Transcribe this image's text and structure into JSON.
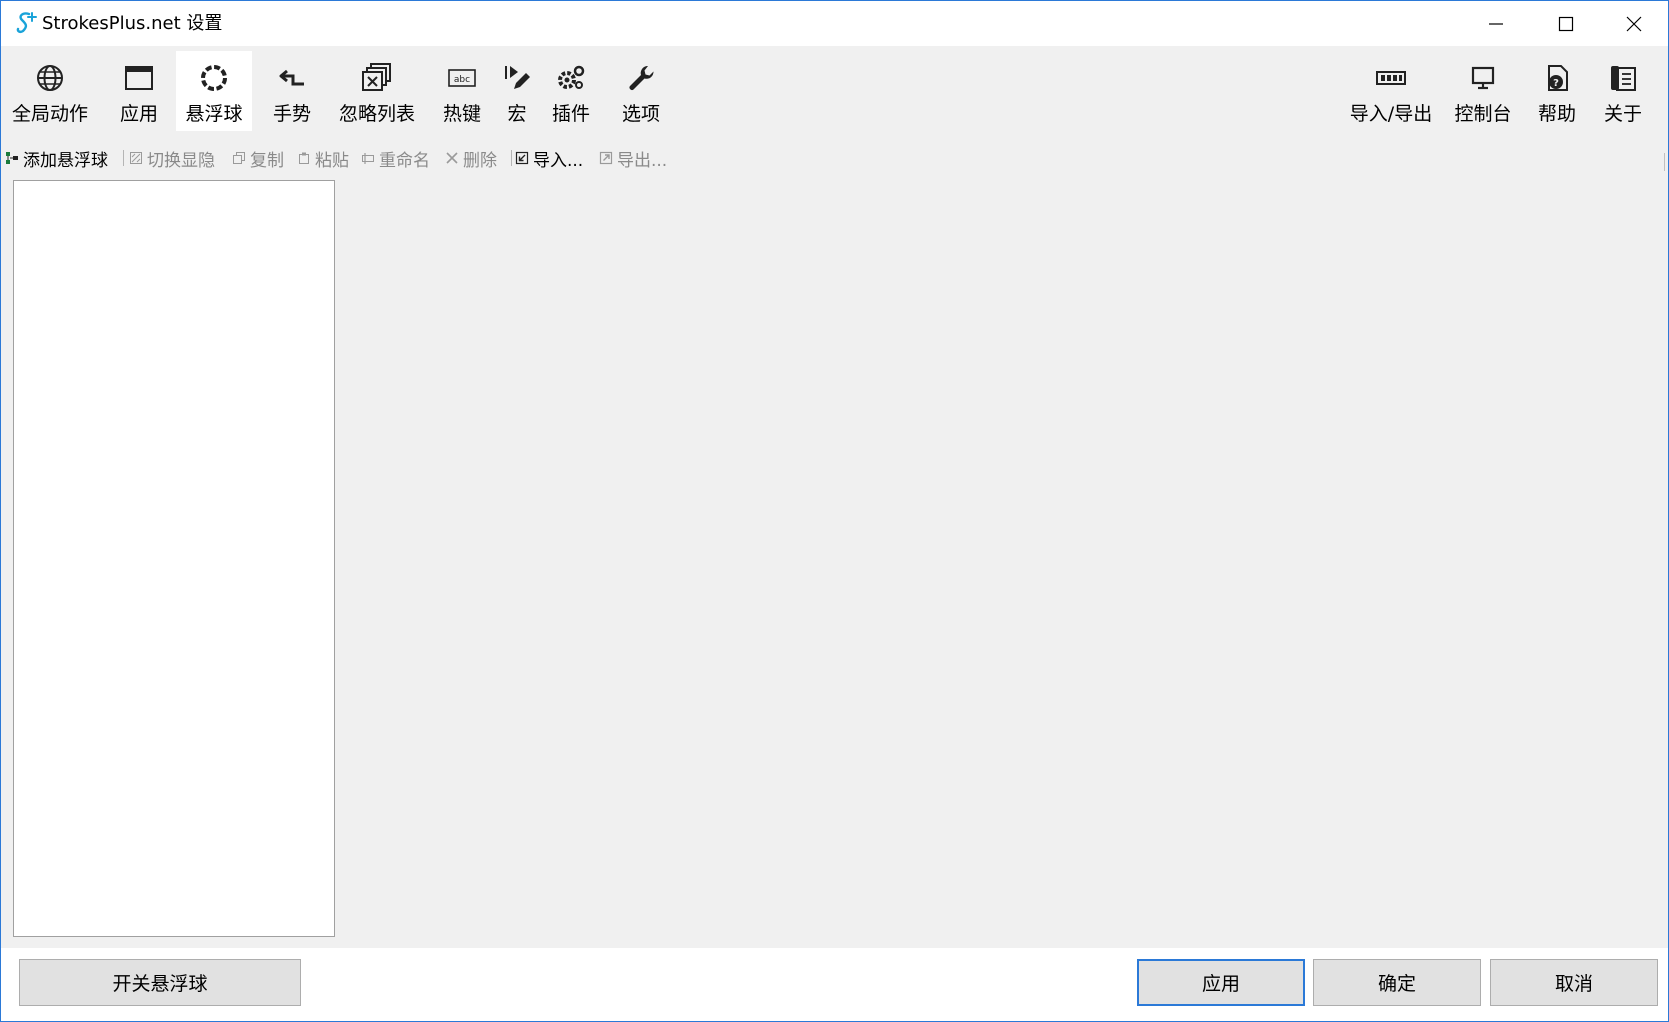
{
  "window": {
    "title": "StrokesPlus.net 设置",
    "accent_color": "#2b79d7",
    "app_icon": "strokesplus-logo-icon"
  },
  "toolbar": {
    "items": [
      {
        "label": "全局动作",
        "icon": "globe-icon"
      },
      {
        "label": "应用",
        "icon": "window-icon"
      },
      {
        "label": "悬浮球",
        "icon": "floating-ring-icon",
        "selected": true
      },
      {
        "label": "手势",
        "icon": "gesture-arrow-icon"
      },
      {
        "label": "忽略列表",
        "icon": "ignore-list-icon"
      },
      {
        "label": "热键",
        "icon": "hotkey-abc-icon"
      },
      {
        "label": "宏",
        "icon": "macro-icon"
      },
      {
        "label": "插件",
        "icon": "plugin-gear-icon"
      },
      {
        "label": "选项",
        "icon": "wrench-icon"
      }
    ],
    "right_items": [
      {
        "label": "导入/导出",
        "icon": "import-export-icon"
      },
      {
        "label": "控制台",
        "icon": "monitor-icon"
      },
      {
        "label": "帮助",
        "icon": "help-document-icon"
      },
      {
        "label": "关于",
        "icon": "about-book-icon"
      }
    ]
  },
  "subtoolbar": {
    "add": "添加悬浮球",
    "toggle": "切换显隐",
    "copy": "复制",
    "paste": "粘贴",
    "rename": "重命名",
    "delete": "删除",
    "import": "导入...",
    "export": "导出..."
  },
  "bottom": {
    "toggle_button": "开关悬浮球",
    "apply_button": "应用",
    "ok_button": "确定",
    "cancel_button": "取消"
  }
}
